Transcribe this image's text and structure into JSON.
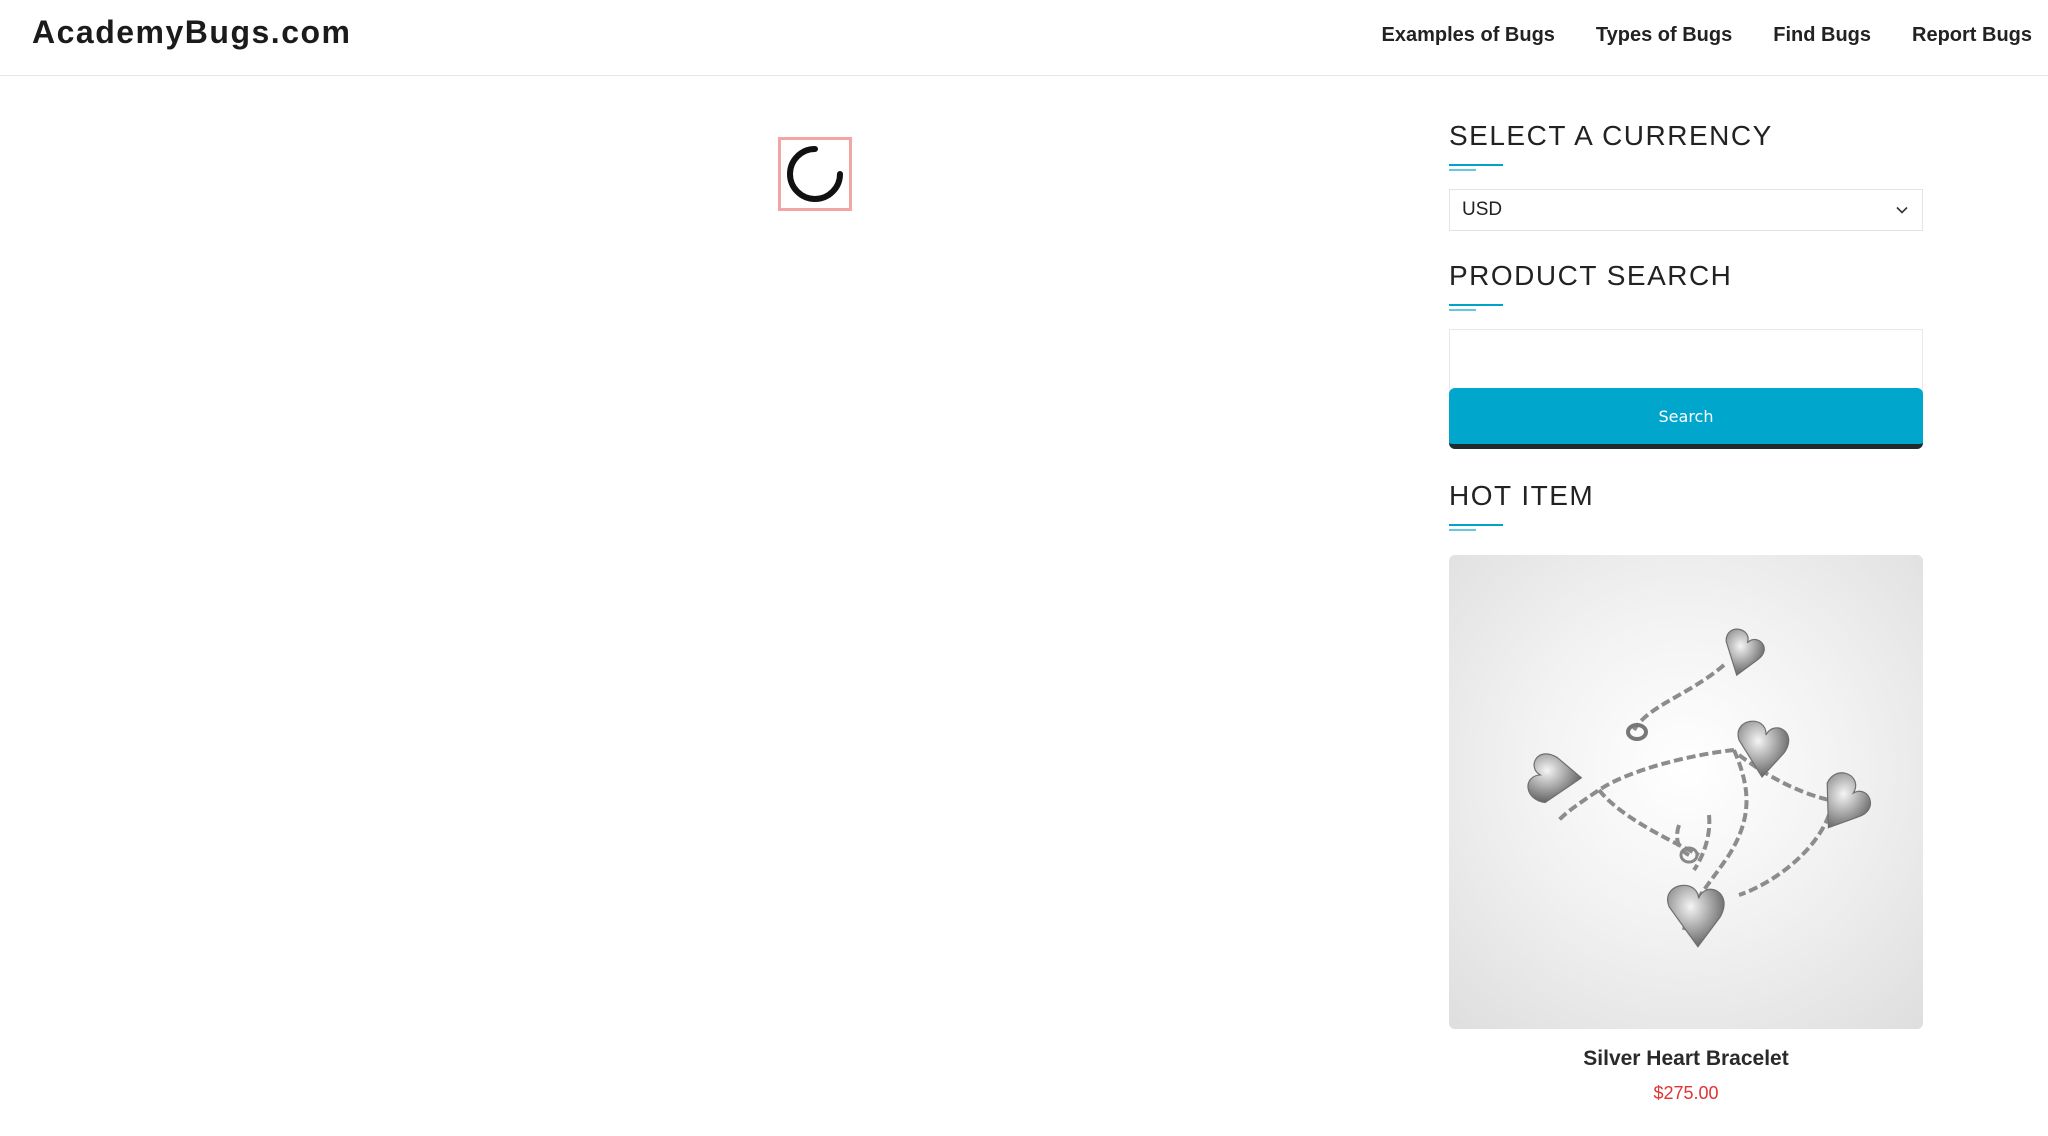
{
  "header": {
    "logo": "AcademyBugs.com",
    "nav": [
      {
        "label": "Examples of Bugs"
      },
      {
        "label": "Types of Bugs"
      },
      {
        "label": "Find Bugs"
      },
      {
        "label": "Report Bugs"
      }
    ]
  },
  "main": {
    "loading_icon": "loading-spinner-icon"
  },
  "sidebar": {
    "currency": {
      "title": "SELECT A CURRENCY",
      "selected": "USD",
      "icon": "chevron-down-icon"
    },
    "search": {
      "title": "PRODUCT SEARCH",
      "input_value": "",
      "placeholder": "",
      "button_label": "Search"
    },
    "hot_item": {
      "title": "HOT ITEM",
      "image_icon": "silver-heart-bracelet-image",
      "name": "Silver Heart Bracelet",
      "price": "$275.00"
    }
  },
  "colors": {
    "accent": "#00a6cc",
    "price": "#e03434",
    "spinner_highlight": "#f3a5a5"
  }
}
